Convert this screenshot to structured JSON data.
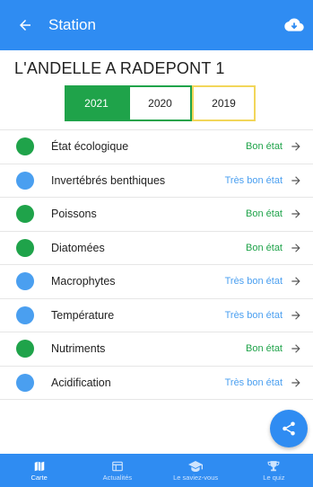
{
  "appbar": {
    "title": "Station"
  },
  "station": {
    "name": "L'ANDELLE A RADEPONT 1"
  },
  "years": [
    {
      "label": "2021",
      "selected": true
    },
    {
      "label": "2020",
      "selected": false
    },
    {
      "label": "2019",
      "selected": false
    }
  ],
  "colors": {
    "primary": "#2f8cf2",
    "green_status": "#1fa34a",
    "blue_status": "#4a9ff0",
    "year_2019_border": "#f2d65a"
  },
  "indicators": [
    {
      "label": "État écologique",
      "status": "Bon état",
      "level": "green"
    },
    {
      "label": "Invertébrés benthiques",
      "status": "Très bon état",
      "level": "blue"
    },
    {
      "label": "Poissons",
      "status": "Bon état",
      "level": "green"
    },
    {
      "label": "Diatomées",
      "status": "Bon état",
      "level": "green"
    },
    {
      "label": "Macrophytes",
      "status": "Très bon état",
      "level": "blue"
    },
    {
      "label": "Température",
      "status": "Très bon état",
      "level": "blue"
    },
    {
      "label": "Nutriments",
      "status": "Bon état",
      "level": "green"
    },
    {
      "label": "Acidification",
      "status": "Très bon état",
      "level": "blue"
    }
  ],
  "bottomnav": [
    {
      "label": "Carte",
      "icon": "map-icon",
      "active": true
    },
    {
      "label": "Actualités",
      "icon": "news-icon",
      "active": false
    },
    {
      "label": "Le saviez-vous",
      "icon": "graduation-cap-icon",
      "active": false
    },
    {
      "label": "Le quiz",
      "icon": "trophy-icon",
      "active": false
    }
  ]
}
